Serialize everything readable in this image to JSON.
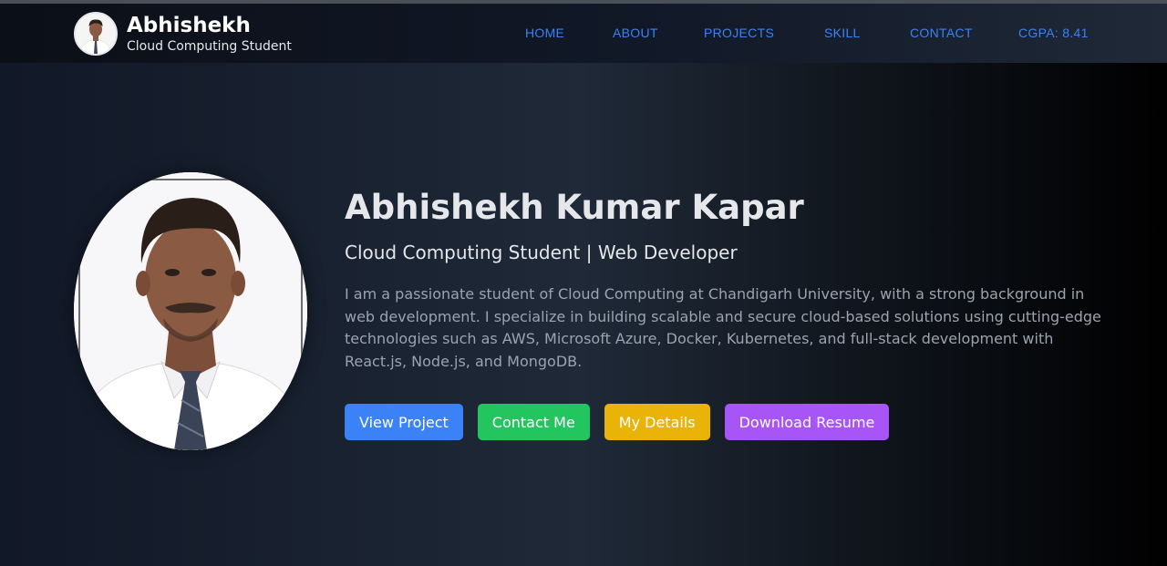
{
  "navbar": {
    "brand_name": "Abhishekh",
    "brand_subtitle": "Cloud Computing Student",
    "links": [
      {
        "label": "HOME"
      },
      {
        "label": "ABOUT"
      },
      {
        "label": "PROJECTS"
      },
      {
        "label": "SKILL"
      },
      {
        "label": "CONTACT"
      },
      {
        "label": "CGPA: 8.41"
      }
    ]
  },
  "hero": {
    "name": "Abhishekh Kumar Kapar",
    "role": "Cloud Computing Student | Web Developer",
    "bio": "I am a passionate student of Cloud Computing at Chandigarh University, with a strong background in web development. I specialize in building scalable and secure cloud-based solutions using cutting-edge technologies such as AWS, Microsoft Azure, Docker, Kubernetes, and full-stack development with React.js, Node.js, and MongoDB.",
    "buttons": {
      "view_project": "View Project",
      "contact_me": "Contact Me",
      "my_details": "My Details",
      "download_resume": "Download Resume"
    }
  },
  "colors": {
    "accent_link": "#3b82f6",
    "btn_blue": "#3b82f6",
    "btn_green": "#22c55e",
    "btn_yellow": "#eab308",
    "btn_purple": "#a855f7"
  }
}
